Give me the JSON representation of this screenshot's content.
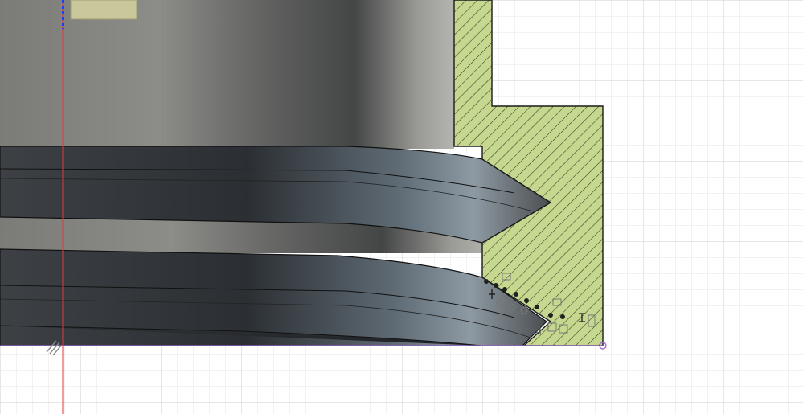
{
  "viewport": {
    "name": "cad-sketch-viewport",
    "background": "#ffffff",
    "grid": {
      "minor_color": "#e4e4e4",
      "major_color": "#cfcfcf",
      "visible": true
    }
  },
  "colors": {
    "section_fill": "#c6d88f",
    "section_hatch": "#2f3a1f",
    "body_light": "#9a9a96",
    "body_dark": "#3f4040",
    "thread_dark": "#2a2d30",
    "thread_highlight": "#8e9aa3",
    "vertical_axis": "#e03a3a",
    "origin_axis": "#1e3cff",
    "profile_edge": "#a46ad6",
    "constraint_glyph": "#202020"
  },
  "icons": {
    "sketch_point": "sketch-point-icon",
    "constraint": "constraint-glyph-icon",
    "origin_marker": "origin-hatch-icon"
  }
}
